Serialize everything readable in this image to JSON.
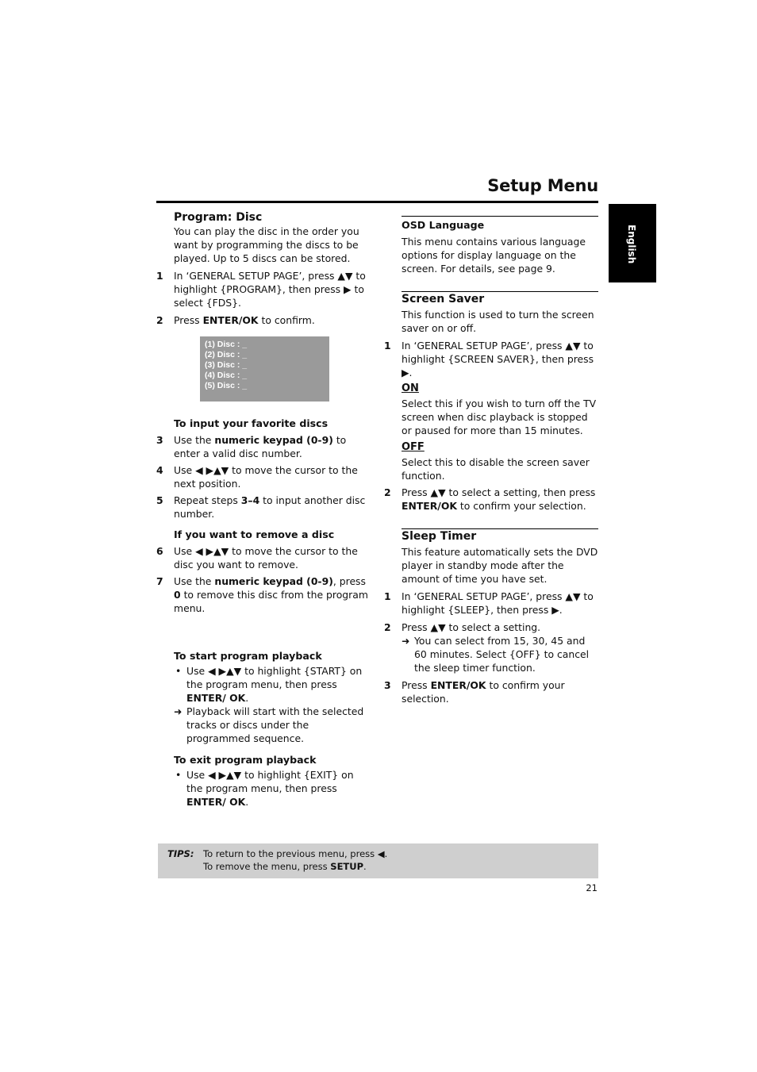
{
  "header": {
    "title": "Setup Menu",
    "language_tab": "English"
  },
  "left": {
    "program_disc": {
      "title": "Program: Disc",
      "intro": "You can play the disc in the order you want by programming the discs to be played. Up to 5 discs can be stored.",
      "step1_num": "1",
      "step1": "In ‘GENERAL SETUP PAGE’, press ▲▼ to highlight {PROGRAM}, then press ▶ to select {FDS}.",
      "step2_num": "2",
      "step2_pre": "Press ",
      "step2_bold": "ENTER/OK",
      "step2_post": " to confirm."
    },
    "osd_screen": [
      "(1)  Disc : _",
      "(2)  Disc : _",
      "(3)  Disc : _",
      "(4)  Disc : _",
      "(5)  Disc : _"
    ],
    "input": {
      "title": "To input your favorite discs",
      "step3_num": "3",
      "step3_pre": "Use the ",
      "step3_bold": "numeric keypad (0-9)",
      "step3_post": " to enter a valid disc number.",
      "step4_num": "4",
      "step4": "Use ◀ ▶▲▼ to move the cursor to the next position.",
      "step5_num": "5",
      "step5_pre": "Repeat steps ",
      "step5_bold": "3–4",
      "step5_post": " to input another disc number."
    },
    "remove": {
      "title": "If you want to remove a disc",
      "step6_num": "6",
      "step6": "Use ◀ ▶▲▼ to move the cursor to the disc you want to remove.",
      "step7_num": "7",
      "step7_pre": "Use the ",
      "step7_bold": "numeric keypad (0-9)",
      "step7_mid": ", press ",
      "step7_bold2": "0",
      "step7_post": " to remove this disc from the program menu."
    },
    "start": {
      "title": "To start program playback",
      "bullet_pre": "Use ◀ ▶▲▼ to highlight {START} on the program menu, then press ",
      "bullet_bold": "ENTER/ OK",
      "bullet_post": ".",
      "result": "Playback will start with the selected tracks or discs under the programmed sequence."
    },
    "exit": {
      "title": "To exit program playback",
      "bullet_pre": "Use ◀ ▶▲▼ to highlight {EXIT} on the program menu, then press ",
      "bullet_bold": "ENTER/ OK",
      "bullet_post": "."
    }
  },
  "right": {
    "osd_language": {
      "title": "OSD Language",
      "body": "This menu contains various language options for display language on the screen. For details, see page 9."
    },
    "screen_saver": {
      "title": "Screen Saver",
      "intro": "This function is used to turn the screen saver on or off.",
      "step1_num": "1",
      "step1": "In ‘GENERAL SETUP PAGE’, press ▲▼ to highlight {SCREEN SAVER}, then press ▶.",
      "on_label": "ON",
      "on_body": "Select this if you wish to turn off the TV screen when disc playback is stopped or paused for more than 15 minutes.",
      "off_label": "OFF",
      "off_body": "Select this to disable the screen saver function.",
      "step2_num": "2",
      "step2_pre": "Press ▲▼ to select a setting, then press ",
      "step2_bold": "ENTER/OK",
      "step2_post": " to confirm your selection."
    },
    "sleep_timer": {
      "title": "Sleep Timer",
      "intro": "This feature automatically sets the DVD player in standby mode after the amount of time you have set.",
      "step1_num": "1",
      "step1": "In ‘GENERAL SETUP PAGE’, press ▲▼ to highlight {SLEEP}, then press ▶.",
      "step2_num": "2",
      "step2": "Press ▲▼ to select a setting.",
      "step2_result": "You can select from 15, 30, 45 and 60 minutes. Select {OFF} to cancel the sleep timer function.",
      "step3_num": "3",
      "step3_pre": "Press ",
      "step3_bold": "ENTER/OK",
      "step3_post": " to confirm your selection."
    }
  },
  "tips": {
    "label": "TIPS:",
    "line1": "To return to the previous menu, press ◀.",
    "line2_pre": "To remove the menu, press ",
    "line2_bold": "SETUP",
    "line2_post": "."
  },
  "footer": {
    "page_number": "21"
  },
  "glyphs": {
    "arrow": "➜",
    "bullet": "•"
  }
}
